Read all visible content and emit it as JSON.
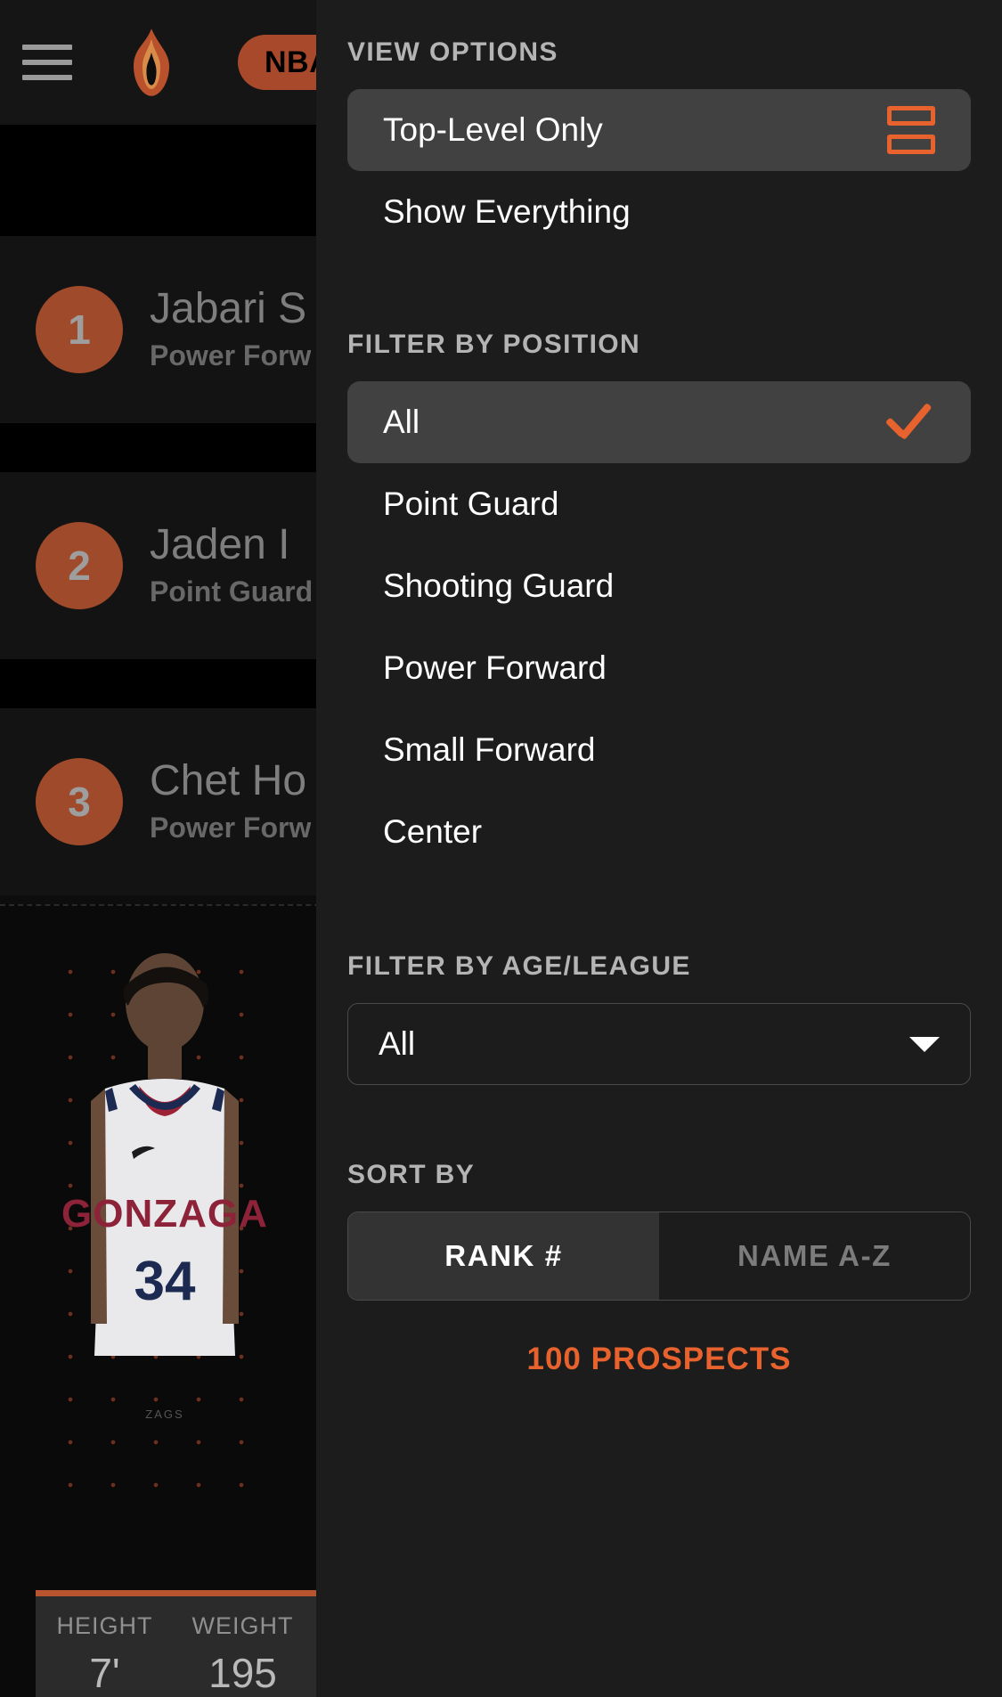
{
  "header": {
    "menu_icon": "hamburger-icon",
    "logo_icon": "flame-logo-icon",
    "badge_label": "NBA"
  },
  "background_list": {
    "rows": [
      {
        "rank": "1",
        "name": "Jabari S",
        "position": "Power Forw"
      },
      {
        "rank": "2",
        "name": "Jaden I",
        "position": "Point Guard"
      },
      {
        "rank": "3",
        "name": "Chet Ho",
        "position": "Power Forw"
      }
    ]
  },
  "player_card": {
    "team": "GONZAGA",
    "jersey_number": "34",
    "stats": [
      {
        "label": "HEIGHT",
        "value": "7'"
      },
      {
        "label": "WEIGHT",
        "value": "195"
      }
    ]
  },
  "panel": {
    "view_options": {
      "title": "VIEW OPTIONS",
      "items": [
        {
          "label": "Top-Level Only",
          "selected": true,
          "icon": "rows-layout-icon"
        },
        {
          "label": "Show Everything",
          "selected": false,
          "icon": ""
        }
      ]
    },
    "filter_position": {
      "title": "FILTER BY POSITION",
      "items": [
        {
          "label": "All",
          "selected": true,
          "icon": "check-icon"
        },
        {
          "label": "Point Guard",
          "selected": false,
          "icon": ""
        },
        {
          "label": "Shooting Guard",
          "selected": false,
          "icon": ""
        },
        {
          "label": "Power Forward",
          "selected": false,
          "icon": ""
        },
        {
          "label": "Small Forward",
          "selected": false,
          "icon": ""
        },
        {
          "label": "Center",
          "selected": false,
          "icon": ""
        }
      ]
    },
    "filter_age_league": {
      "title": "FILTER BY AGE/LEAGUE",
      "selected_value": "All",
      "caret_icon": "chevron-down-icon"
    },
    "sort_by": {
      "title": "SORT BY",
      "options": [
        {
          "label": "RANK #",
          "active": true
        },
        {
          "label": "NAME A-Z",
          "active": false
        }
      ]
    },
    "result_count": "100 PROSPECTS"
  },
  "colors": {
    "accent": "#e8622e",
    "badge": "#a8492b",
    "panel_bg": "#1c1c1c",
    "selected_row": "#414141"
  }
}
